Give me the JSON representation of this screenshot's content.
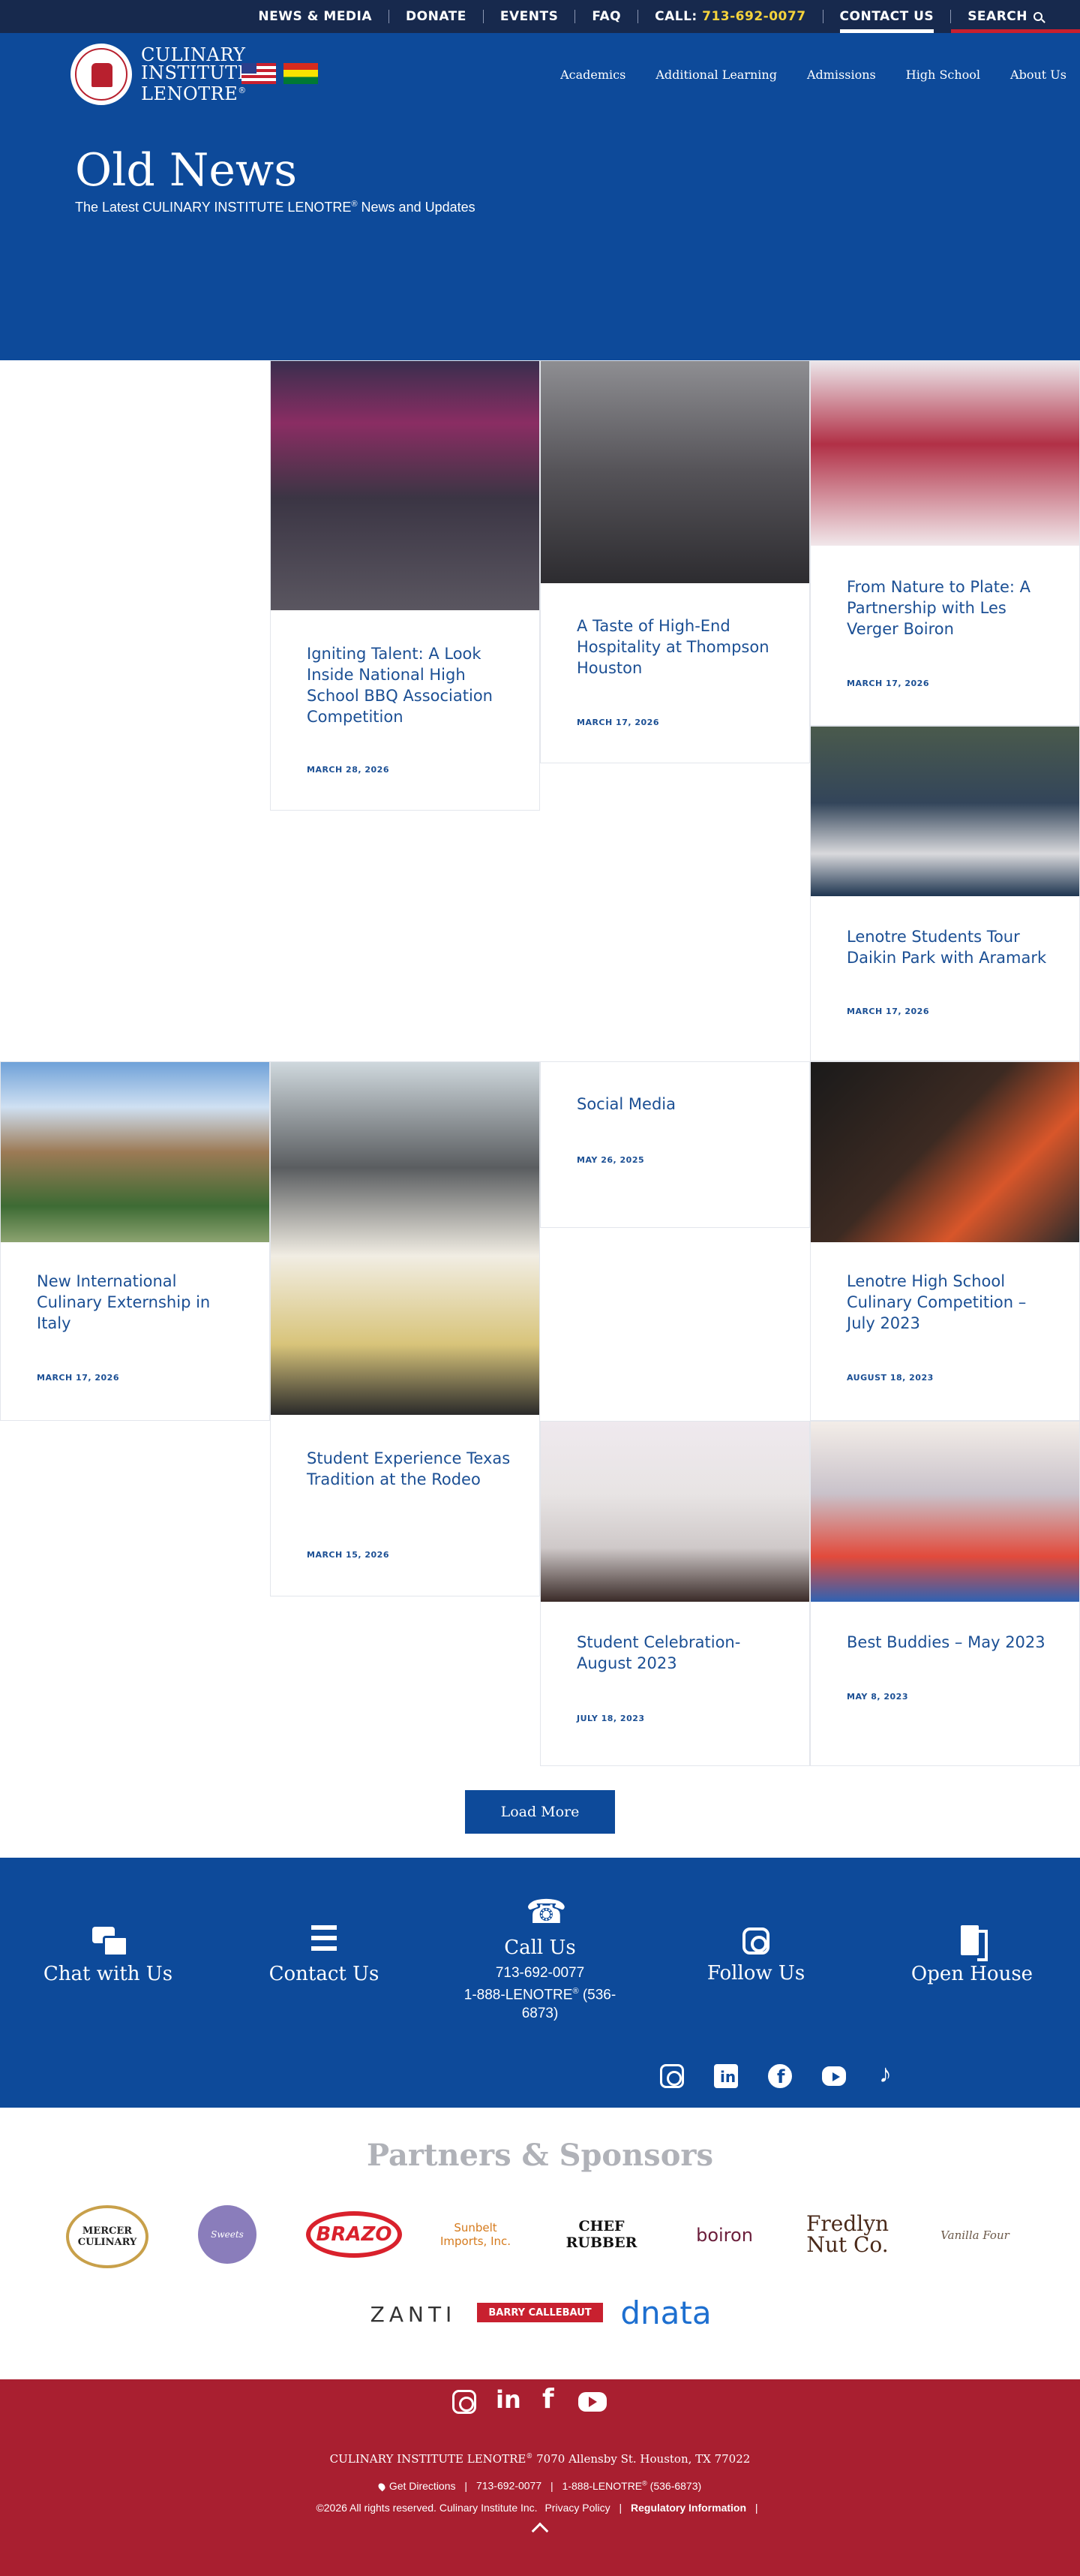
{
  "topbar": {
    "links": [
      "NEWS & MEDIA",
      "DONATE",
      "EVENTS",
      "FAQ"
    ],
    "call_label": "CALL:",
    "call_number": "713-692-0077",
    "contact": "CONTACT US",
    "search": "SEARCH"
  },
  "header": {
    "logo_line1": "CULINARY",
    "logo_line2": "INSTITUTE",
    "logo_line3": "LENOTRE",
    "logo_mark": "®",
    "nav": [
      "Academics",
      "Additional Learning",
      "Admissions",
      "High School",
      "About Us"
    ]
  },
  "hero": {
    "title": "Old News",
    "subtitle_pre": "The Latest CULINARY INSTITUTE LENOTRE",
    "subtitle_mark": "®",
    "subtitle_post": " News and Updates"
  },
  "posts": [
    {
      "title": "Igniting Talent: A Look Inside National High School BBQ Association Competition",
      "date": "MARCH 28, 2026"
    },
    {
      "title": "A Taste of High-End Hospitality at Thompson Houston",
      "date": "MARCH 17, 2026"
    },
    {
      "title": "From Nature to Plate: A Partnership with Les Verger Boiron",
      "date": "MARCH 17, 2026"
    },
    {
      "title": "Lenotre Students Tour Daikin Park with Aramark",
      "date": "MARCH 17, 2026"
    },
    {
      "title": "New International Culinary Externship in Italy",
      "date": "MARCH 17, 2026"
    },
    {
      "title": "Student Experience Texas Tradition at the Rodeo",
      "date": "MARCH 15, 2026"
    },
    {
      "title": "Social Media",
      "date": "MAY 26, 2025"
    },
    {
      "title": "Lenotre High School Culinary Competition – July 2023",
      "date": "AUGUST 18, 2023"
    },
    {
      "title": "Student Celebration- August 2023",
      "date": "JULY 18, 2023"
    },
    {
      "title": "Best Buddies – May 2023",
      "date": "MAY 8, 2023"
    }
  ],
  "load_more": "Load More",
  "cta": {
    "chat": "Chat with Us",
    "contact": "Contact Us",
    "call": "Call Us",
    "call_line1": "713-692-0077",
    "call_line2_pre": "1-888-LENOTRE",
    "call_line2_mark": "®",
    "call_line2_post": " (536-",
    "call_line3": "6873)",
    "follow": "Follow Us",
    "open_house": "Open House"
  },
  "partners": {
    "title": "Partners & Sponsors",
    "logos": {
      "mercer": "MERCER CULINARY",
      "sweets": "Sweets",
      "brazo": "BRAZO",
      "sunbelt": "Sunbelt Imports, Inc.",
      "chefrubber": "CHEF RUBBER",
      "boiron": "boiron",
      "fredlyn": "Fredlyn Nut Co.",
      "vanilla": "Vanilla Four",
      "zanti": "ZANTI",
      "barry": "BARRY CALLEBAUT",
      "dnata": "dnata"
    }
  },
  "footer": {
    "address_name": "CULINARY INSTITUTE LENOTRE",
    "address_mark": "®",
    "address_street": " 7070 Allensby St. Houston, TX 77022",
    "directions": "Get Directions",
    "phone1": "713-692-0077",
    "phone2": "1-888-LENOTRE",
    "phone2_mark": "®",
    "phone2_post": " (536-6873)",
    "copyright": "©2026 All rights reserved. Culinary Institute Inc.",
    "privacy": "Privacy Policy",
    "regulatory": "Regulatory Information"
  },
  "colors": {
    "navy": "#17294d",
    "brand_blue": "#0d4a9a",
    "brand_red": "#a91f30",
    "accent_yellow": "#f5d33c"
  }
}
